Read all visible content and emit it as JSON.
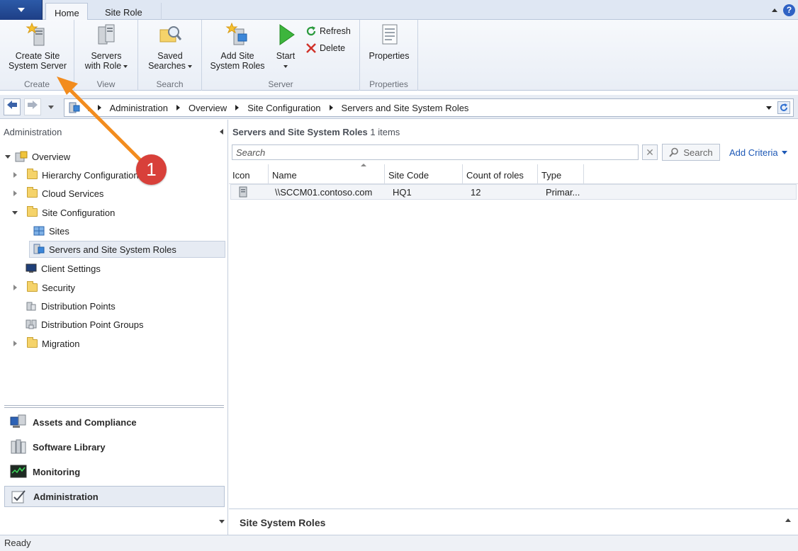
{
  "ribbon": {
    "tabs": [
      {
        "label": "Home",
        "active": true
      },
      {
        "label": "Site Role",
        "active": false
      }
    ],
    "groups": {
      "create": {
        "label": "Create",
        "buttons": [
          {
            "label": "Create Site\nSystem Server",
            "icon": "server-star-icon"
          }
        ]
      },
      "view": {
        "label": "View",
        "buttons": [
          {
            "label": "Servers\nwith Role",
            "icon": "servers-role-icon",
            "dropdown": true
          }
        ]
      },
      "search": {
        "label": "Search",
        "buttons": [
          {
            "label": "Saved\nSearches",
            "icon": "saved-searches-icon",
            "dropdown": true
          }
        ]
      },
      "server": {
        "label": "Server",
        "add_roles": "Add Site\nSystem Roles",
        "start": "Start",
        "refresh": "Refresh",
        "delete": "Delete"
      },
      "properties": {
        "label": "Properties",
        "properties": "Properties"
      }
    }
  },
  "nav": {
    "breadcrumb": [
      "\\",
      "Administration",
      "Overview",
      "Site Configuration",
      "Servers and Site System Roles"
    ]
  },
  "left_pane": {
    "title": "Administration",
    "tree": [
      {
        "label": "Overview",
        "level": 0,
        "expanded": true,
        "icon": "overview-icon"
      },
      {
        "label": "Hierarchy Configuration",
        "level": 1,
        "expandable": true,
        "icon": "folder-icon"
      },
      {
        "label": "Cloud Services",
        "level": 1,
        "expandable": true,
        "icon": "folder-icon"
      },
      {
        "label": "Site Configuration",
        "level": 1,
        "expanded": true,
        "icon": "folder-icon"
      },
      {
        "label": "Sites",
        "level": 2,
        "icon": "sites-icon"
      },
      {
        "label": "Servers and Site System Roles",
        "level": 2,
        "selected": true,
        "icon": "servers-roles-icon"
      },
      {
        "label": "Client Settings",
        "level": 1,
        "icon": "client-settings-icon"
      },
      {
        "label": "Security",
        "level": 1,
        "expandable": true,
        "icon": "folder-icon"
      },
      {
        "label": "Distribution Points",
        "level": 1,
        "icon": "distribution-points-icon"
      },
      {
        "label": "Distribution Point Groups",
        "level": 1,
        "icon": "distribution-point-groups-icon"
      },
      {
        "label": "Migration",
        "level": 1,
        "expandable": true,
        "icon": "folder-icon"
      }
    ],
    "workspaces": [
      {
        "label": "Assets and Compliance",
        "icon": "assets-compliance-icon"
      },
      {
        "label": "Software Library",
        "icon": "software-library-icon"
      },
      {
        "label": "Monitoring",
        "icon": "monitoring-icon"
      },
      {
        "label": "Administration",
        "icon": "administration-icon",
        "selected": true
      }
    ]
  },
  "main": {
    "title": "Servers and Site System Roles",
    "count": "1 items",
    "search_placeholder": "Search",
    "search_button": "Search",
    "add_criteria": "Add Criteria",
    "columns": [
      "Icon",
      "Name",
      "Site Code",
      "Count of roles",
      "Type"
    ],
    "rows": [
      {
        "name": "\\\\SCCM01.contoso.com",
        "site_code": "HQ1",
        "count_of_roles": "12",
        "type": "Primar..."
      }
    ]
  },
  "details": {
    "title": "Site System Roles"
  },
  "status": {
    "text": "Ready"
  },
  "annotation": {
    "badge": "1",
    "color": "#f28c1e",
    "badge_color": "#d8403a"
  }
}
